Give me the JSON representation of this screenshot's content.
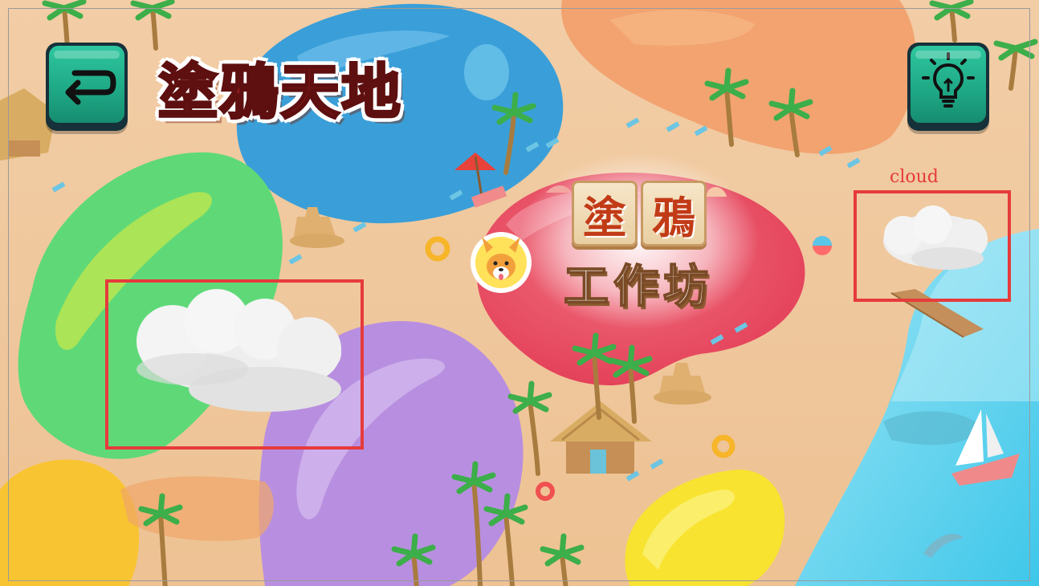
{
  "game": {
    "title": "塗鴉天地",
    "logo_tiles": [
      "塗",
      "鴉"
    ],
    "logo_subtitle": "工作坊"
  },
  "buttons": {
    "back_icon": "return-arrow-icon",
    "hint_icon": "lightbulb-icon"
  },
  "annotations": {
    "cloud_label": "cloud"
  },
  "colors": {
    "button_face": "#1ea784",
    "button_border": "#16313a",
    "title_text": "#8c1d1a",
    "annotation_box": "#e63b3b",
    "sand": "#efc79c",
    "sea": "#5fd0ea"
  }
}
